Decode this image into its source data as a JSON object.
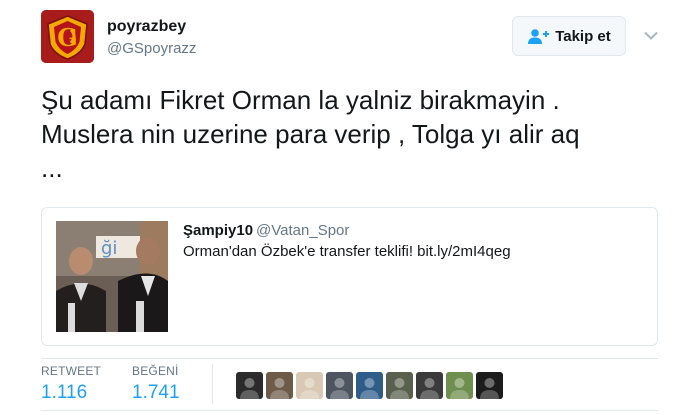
{
  "author": {
    "display_name": "poyrazbey",
    "handle": "@GSpoyrazz",
    "avatar_icon": "galatasaray-crest-icon"
  },
  "follow_button": {
    "label": "Takip et",
    "icon": "add-user-icon"
  },
  "menu_icon": "chevron-down-icon",
  "tweet": {
    "text": "Şu adamı Fikret Orman la yalniz birakmayin .\nMuslera nin uzerine para verip , Tolga yı alir aq\n..."
  },
  "quoted_tweet": {
    "name": "Şampiy10",
    "handle": "@Vatan_Spor",
    "text": "Orman'dan Özbek'e transfer teklifi! bit.ly/2mI4qeg",
    "image_text": "ği"
  },
  "stats": {
    "retweet_label": "RETWEET",
    "retweet_count": "1.116",
    "like_label": "BEĞENİ",
    "like_count": "1.741"
  },
  "likers": [
    {
      "name": "liker-avatar-1",
      "bg": "#2b2b2b"
    },
    {
      "name": "liker-avatar-2",
      "bg": "#6d5a49"
    },
    {
      "name": "liker-avatar-3",
      "bg": "#d9c9b4"
    },
    {
      "name": "liker-avatar-4",
      "bg": "#4d5560"
    },
    {
      "name": "liker-avatar-5",
      "bg": "#2f5d8a"
    },
    {
      "name": "liker-avatar-6",
      "bg": "#59604d"
    },
    {
      "name": "liker-avatar-7",
      "bg": "#3b3b3b"
    },
    {
      "name": "liker-avatar-8",
      "bg": "#6f8f4e"
    },
    {
      "name": "liker-avatar-9",
      "bg": "#1c1c1c"
    }
  ],
  "colors": {
    "link_blue": "#1da1f2",
    "secondary_text": "#657786",
    "border": "#e1e8ed"
  }
}
